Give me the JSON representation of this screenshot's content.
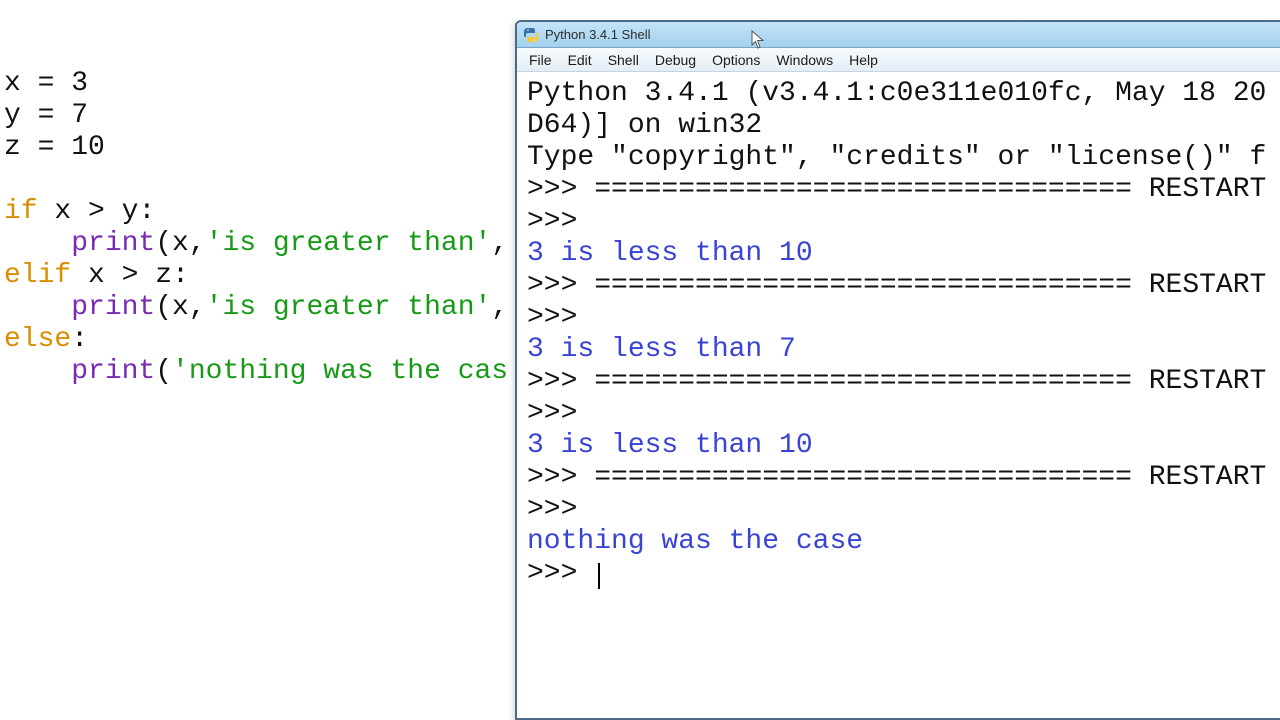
{
  "editor": {
    "lines": [
      [
        [
          "name",
          "x"
        ],
        [
          "op",
          " = "
        ],
        [
          "num",
          "3"
        ]
      ],
      [
        [
          "name",
          "y"
        ],
        [
          "op",
          " = "
        ],
        [
          "num",
          "7"
        ]
      ],
      [
        [
          "name",
          "z"
        ],
        [
          "op",
          " = "
        ],
        [
          "num",
          "10"
        ]
      ],
      [],
      [
        [
          "kw",
          "if"
        ],
        [
          "name",
          " x "
        ],
        [
          "op",
          ">"
        ],
        [
          "name",
          " y"
        ],
        [
          "punc",
          ":"
        ]
      ],
      [
        [
          "punc",
          "    "
        ],
        [
          "func",
          "print"
        ],
        [
          "punc",
          "("
        ],
        [
          "name",
          "x"
        ],
        [
          "punc",
          ","
        ],
        [
          "str",
          "'is greater than'"
        ],
        [
          "punc",
          ","
        ]
      ],
      [
        [
          "kw",
          "elif"
        ],
        [
          "name",
          " x "
        ],
        [
          "op",
          ">"
        ],
        [
          "name",
          " z"
        ],
        [
          "punc",
          ":"
        ]
      ],
      [
        [
          "punc",
          "    "
        ],
        [
          "func",
          "print"
        ],
        [
          "punc",
          "("
        ],
        [
          "name",
          "x"
        ],
        [
          "punc",
          ","
        ],
        [
          "str",
          "'is greater than'"
        ],
        [
          "punc",
          ","
        ]
      ],
      [
        [
          "kw",
          "else"
        ],
        [
          "punc",
          ":"
        ]
      ],
      [
        [
          "punc",
          "    "
        ],
        [
          "func",
          "print"
        ],
        [
          "punc",
          "("
        ],
        [
          "str",
          "'nothing was the cas"
        ]
      ]
    ]
  },
  "shell": {
    "title": "Python 3.4.1 Shell",
    "menu": [
      "File",
      "Edit",
      "Shell",
      "Debug",
      "Options",
      "Windows",
      "Help"
    ],
    "banner": [
      "Python 3.4.1 (v3.4.1:c0e311e010fc, May 18 20",
      "D64)] on win32",
      "Type \"copyright\", \"credits\" or \"license()\" f"
    ],
    "lines": [
      {
        "kind": "divider",
        "prompt": ">>> ",
        "text": "================================ RESTART"
      },
      {
        "kind": "prompt",
        "prompt": ">>> ",
        "text": ""
      },
      {
        "kind": "output",
        "text": "3 is less than 10"
      },
      {
        "kind": "divider",
        "prompt": ">>> ",
        "text": "================================ RESTART"
      },
      {
        "kind": "prompt",
        "prompt": ">>> ",
        "text": ""
      },
      {
        "kind": "output",
        "text": "3 is less than 7"
      },
      {
        "kind": "divider",
        "prompt": ">>> ",
        "text": "================================ RESTART"
      },
      {
        "kind": "prompt",
        "prompt": ">>> ",
        "text": ""
      },
      {
        "kind": "output",
        "text": "3 is less than 10"
      },
      {
        "kind": "divider",
        "prompt": ">>> ",
        "text": "================================ RESTART"
      },
      {
        "kind": "prompt",
        "prompt": ">>> ",
        "text": ""
      },
      {
        "kind": "output",
        "text": "nothing was the case"
      },
      {
        "kind": "prompt-cursor",
        "prompt": ">>> ",
        "text": ""
      }
    ]
  }
}
